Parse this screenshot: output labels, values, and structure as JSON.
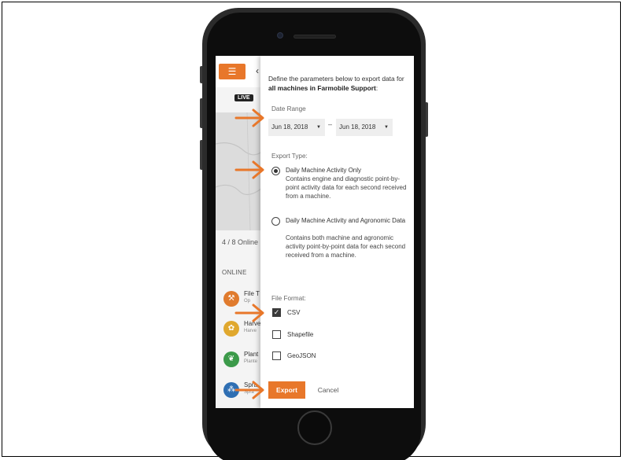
{
  "background_app": {
    "menu_icon": "hamburger-icon",
    "back_icon": "chevron-left-icon",
    "live_badge": "LIVE",
    "online_count": "4 / 8 Online",
    "online_section": "ONLINE",
    "machines": [
      {
        "name": "File T",
        "sub": "Op",
        "icon": "wrench-icon",
        "color": "#e07b2e"
      },
      {
        "name": "Harve",
        "sub": "Harve",
        "icon": "wheat-icon",
        "color": "#e0a82e"
      },
      {
        "name": "Plant",
        "sub": "Plante",
        "icon": "leaf-icon",
        "color": "#3c9a4a"
      },
      {
        "name": "Spra",
        "sub": "Spra",
        "icon": "sprayer-icon",
        "color": "#2f6fb3"
      }
    ]
  },
  "export_panel": {
    "intro_prefix": "Define the parameters below to export data for ",
    "intro_bold": "all machines in Farmobile Support",
    "intro_suffix": ":",
    "date_range_label": "Date Range",
    "date_from": "Jun 18, 2018",
    "date_separator": "–",
    "date_to": "Jun 18, 2018",
    "export_type_label": "Export Type:",
    "export_types": [
      {
        "title": "Daily Machine Activity Only",
        "description": "Contains engine and diagnostic point-by-point activity data for each second received from a machine.",
        "checked": true
      },
      {
        "title": "Daily Machine Activity and Agronomic Data",
        "description": "Contains both machine and agronomic activity point-by-point data for each second received from a machine.",
        "checked": false
      }
    ],
    "file_format_label": "File Format:",
    "file_formats": [
      {
        "label": "CSV",
        "checked": true
      },
      {
        "label": "Shapefile",
        "checked": false
      },
      {
        "label": "GeoJSON",
        "checked": false
      }
    ],
    "export_button": "Export",
    "cancel_button": "Cancel"
  },
  "colors": {
    "accent_orange": "#e8772a",
    "annotation_arrow": "#e8772a",
    "phone_body": "#1a1a1a"
  }
}
